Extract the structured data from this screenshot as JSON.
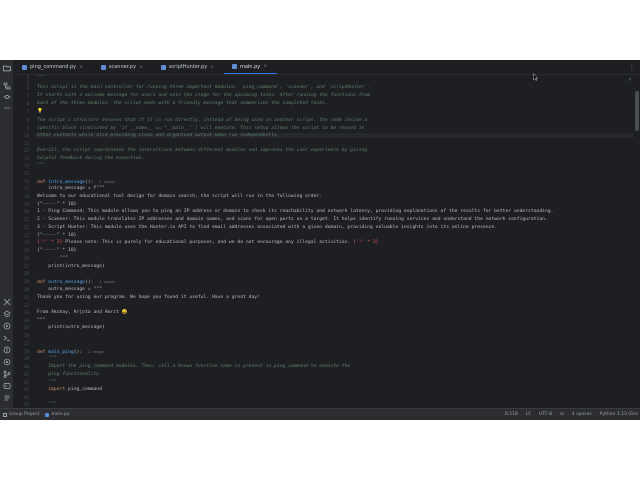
{
  "tabs": [
    {
      "label": "ping_command.py",
      "active": false
    },
    {
      "label": "scanner.py",
      "active": false
    },
    {
      "label": "scriptHunter.py",
      "active": false
    },
    {
      "label": "main.py",
      "active": true
    }
  ],
  "line_numbers": [
    "2",
    "3",
    "4",
    "5",
    "6",
    "7",
    "8",
    "9",
    "10",
    "11",
    "12",
    "13",
    "14",
    "15",
    "16",
    "17",
    "18",
    "19",
    "20",
    "21",
    "22",
    "23",
    "24",
    "25",
    "26",
    "27",
    "28",
    "29",
    "30",
    "31",
    "32",
    "33",
    "34",
    "35",
    "36",
    "37",
    "38",
    "39",
    "40",
    "41",
    "42",
    "43",
    "44",
    "45",
    "46",
    "47",
    "48",
    "49",
    "50",
    "51",
    "52",
    "53",
    "54",
    "55",
    "56",
    "57",
    "58",
    "59",
    "60",
    "61",
    "62",
    "63",
    "64",
    "65",
    "66"
  ],
  "code": {
    "doc_open": "\"\"\"",
    "doc_p1_l1": "This script is the main controller for running three important modules: `ping_command`, `scanner`, and `scriptHunter`.",
    "doc_p1_l2": "It starts with a welcome message for users and sets the stage for the upcoming tasks. After running the functions from",
    "doc_p1_l3": "each of the three modules, the script ends with a friendly message that summarizes the completed tasks.",
    "doc_p2_l1": "The script's structure ensures that if it is run directly, instead of being used in another script, the code inside a",
    "doc_p2_l2": "specific block (indicated by `if __name__ == \"__main__\"`) will execute. This setup allows the script to be reused in",
    "doc_p2_l3": "other contexts while also providing clean and organized output when run independently.",
    "doc_p3_l1": "Overall, the script coordinates the interactions between different modules and improves the user experience by giving",
    "doc_p3_l2": "helpful feedback during the execution.",
    "doc_close": "\"\"\"",
    "def_kw": "def",
    "intro_fn": "intro_message",
    "parens_colon": "():",
    "usage_hint": "1 usage",
    "intro_assign": "    intro_message = f\"\"\"",
    "welcome": "Welcome to our educational tool design for domain search, the script will run in the following order.",
    "sep1": "{\"-----\" * 10}",
    "item1": "1 - Ping Command: This module allows you to ping an IP address or domain to check its reachability and network latency, providing explanations of the results for better understanding.",
    "item2": "2 - Scanner: This module translates IP addresses and domain names, and scans for open ports on a target. It helps identify running services and understand the network configuration.",
    "item3": "3 - Script Hunter: This module uses the Hunter.io API to find email addresses associated with a given domain, providing valuable insights into its online presence.",
    "sep2": "{\"-----\" * 10}",
    "warn_pre": "{'!' * 3}",
    "warn_text": " Please note: This is purely for educational purposes, and we do not encourage any illegal activities. ",
    "warn_post": "{'!' * 3}",
    "sep3": "{\"-----\" * 10}",
    "tq1": "        \"\"\"",
    "print_intro": "    print(intro_message)",
    "outro_fn": "outro_message",
    "outro_assign": "    outro_message = \"\"\"",
    "thanks": "Thank you for using our program. We hope you found it useful. Have a great day!",
    "from_line": "From Akshay, Arjota and Amrit 😀",
    "tq2": "\"\"\"",
    "print_outro": "    print(outro_message)",
    "main_ping_fn": "main_ping",
    "doc4_open": "    \"\"\"",
    "doc4_l1": "    Import the ping_command modules. Then, call a known function name is present in ping_command to execute the",
    "doc4_l2": "    ping functionality.",
    "doc4_close": "    \"\"\"",
    "import_kw": "    import",
    "import_mod": " ping_command",
    "tail": "    \"\"\""
  },
  "status_bar": {
    "project": "Group Project",
    "file": "main.py",
    "position": "8:118",
    "line_ending": "LF",
    "encoding": "UTF-8",
    "indent": "4 spaces",
    "interpreter": "Python 3.13 (Gro"
  },
  "colors": {
    "editor_bg": "#1e1f22",
    "docstring": "#5f826b",
    "keyword": "#cf8e6d",
    "function": "#56a8f5",
    "string": "#6aab73",
    "warning": "#f75464",
    "accent": "#3574f0"
  },
  "icons": {
    "left_top": [
      "folder-icon",
      "structure-icon",
      "commit-icon",
      "more-icon"
    ],
    "left_bottom": [
      "plugins-icon",
      "layers-icon",
      "run-icon",
      "terminal-icon",
      "problems-icon",
      "services-icon",
      "git-icon",
      "python-console-icon",
      "todo-icon",
      "notifications-icon"
    ]
  }
}
